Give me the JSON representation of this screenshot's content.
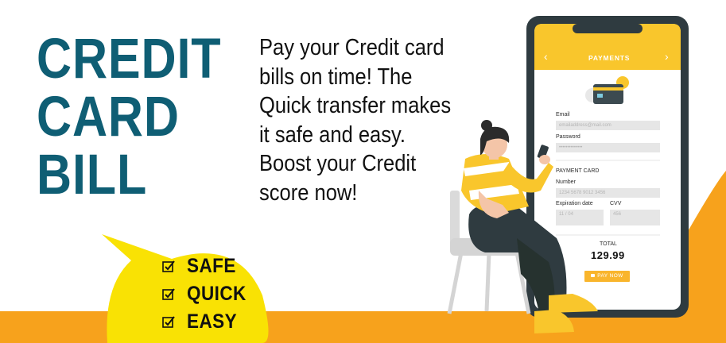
{
  "headline": {
    "line1": "CREDIT",
    "line2": "CARD",
    "line3": "BILL"
  },
  "body_lines": [
    "Pay your Credit card",
    "bills on time! The",
    "Quick transfer makes",
    "it safe and easy.",
    "Boost your Credit",
    "score now!"
  ],
  "features": [
    {
      "icon": "checkbox-checked-icon",
      "label": "SAFE"
    },
    {
      "icon": "checkbox-checked-icon",
      "label": "QUICK"
    },
    {
      "icon": "checkbox-checked-icon",
      "label": "EASY"
    }
  ],
  "phone": {
    "title": "PAYMENTS",
    "back_icon": "chevron-left-icon",
    "forward_icon": "chevron-right-icon",
    "email_label": "Email",
    "email_placeholder": "emailaddress@mail.com",
    "password_label": "Password",
    "password_placeholder": "••••••••••••••",
    "section_title": "PAYMENT CARD",
    "number_label": "Number",
    "number_placeholder": "1234 5678 9012 3456",
    "expiry_label": "Expiration date",
    "expiry_placeholder": "11 / 04",
    "cvv_label": "CVV",
    "cvv_placeholder": "456",
    "total_label": "TOTAL",
    "total_value": "129.99",
    "pay_button": "PAY NOW"
  },
  "colors": {
    "headline": "#0f5e74",
    "accent_yellow": "#f9e204",
    "accent_orange": "#f7a21c",
    "phone_header": "#f9c62c"
  }
}
